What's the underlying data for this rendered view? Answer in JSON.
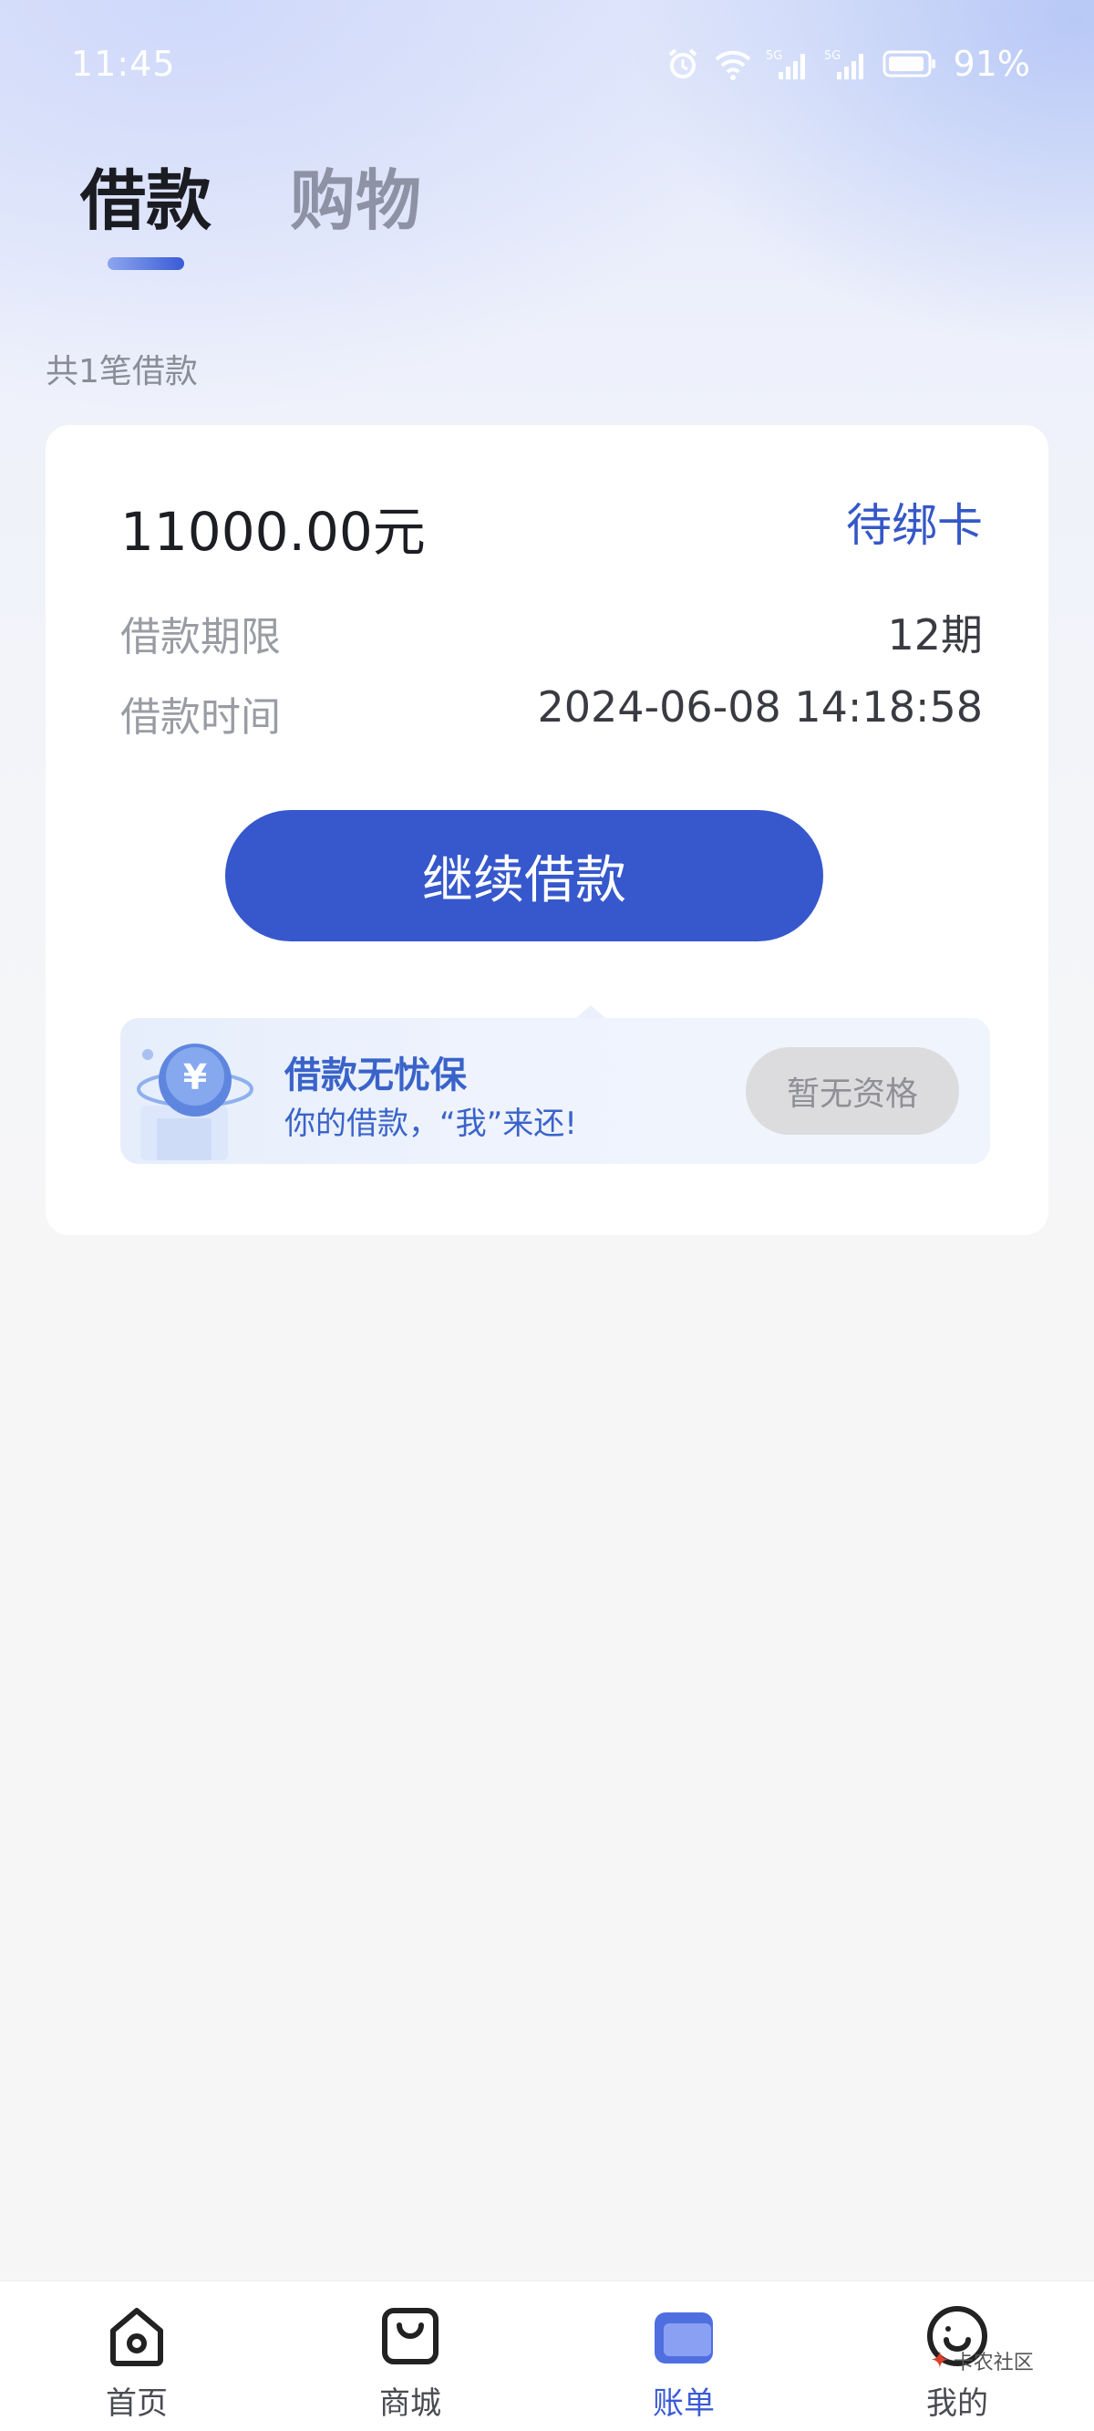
{
  "status_bar": {
    "time": "11:45",
    "battery": "91%"
  },
  "tabs": [
    {
      "label": "借款",
      "active": true
    },
    {
      "label": "购物",
      "active": false
    }
  ],
  "loan_count": "共1笔借款",
  "loan_card": {
    "amount": "11000.00元",
    "status": "待绑卡",
    "term_label": "借款期限",
    "term_value": "12期",
    "time_label": "借款时间",
    "time_value": "2024-06-08 14:18:58",
    "cta_label": "继续借款",
    "insurance": {
      "title": "借款无忧保",
      "subtitle": "你的借款，“我”来还!",
      "button": "暂无资格"
    }
  },
  "bottom_nav": [
    {
      "label": "首页",
      "icon": "home-icon"
    },
    {
      "label": "商城",
      "icon": "shopping-bag-icon"
    },
    {
      "label": "账单",
      "icon": "bill-icon",
      "active": true
    },
    {
      "label": "我的",
      "icon": "profile-icon"
    }
  ],
  "watermark": "卡农社区",
  "colors": {
    "accent": "#3658cc",
    "link": "#3558c7",
    "insurance_text": "#3a63c9"
  }
}
